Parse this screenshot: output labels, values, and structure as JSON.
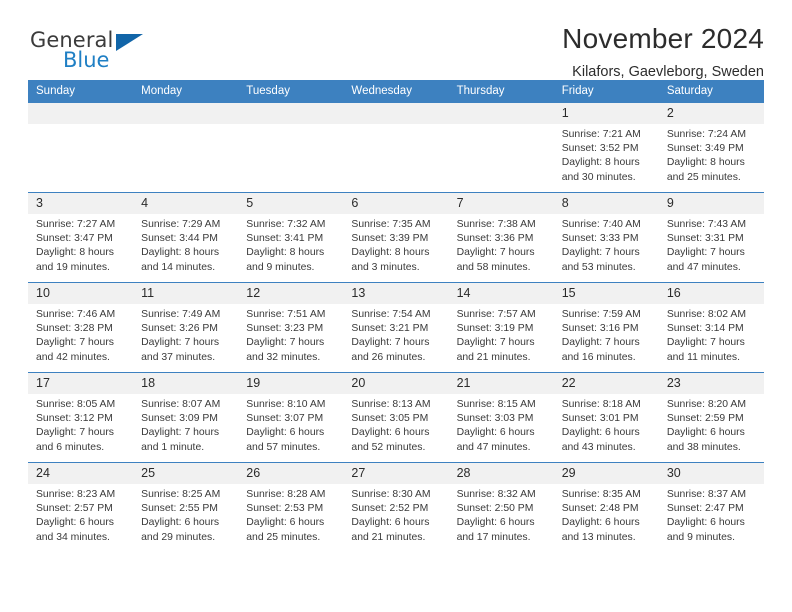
{
  "brand": {
    "name_part1": "General",
    "name_part2": "Blue",
    "triangle_color": "#1165a8",
    "blue_color": "#1f7fc4"
  },
  "header": {
    "title": "November 2024",
    "subtitle": "Kilafors, Gaevleborg, Sweden"
  },
  "theme": {
    "header_bg": "#3d81c0",
    "daynum_bg": "#f1f1f1",
    "row_border": "#3d81c0"
  },
  "weekdays": [
    "Sunday",
    "Monday",
    "Tuesday",
    "Wednesday",
    "Thursday",
    "Friday",
    "Saturday"
  ],
  "weeks": [
    [
      {
        "day": "",
        "sunrise": "",
        "sunset": "",
        "daylight1": "",
        "daylight2": ""
      },
      {
        "day": "",
        "sunrise": "",
        "sunset": "",
        "daylight1": "",
        "daylight2": ""
      },
      {
        "day": "",
        "sunrise": "",
        "sunset": "",
        "daylight1": "",
        "daylight2": ""
      },
      {
        "day": "",
        "sunrise": "",
        "sunset": "",
        "daylight1": "",
        "daylight2": ""
      },
      {
        "day": "",
        "sunrise": "",
        "sunset": "",
        "daylight1": "",
        "daylight2": ""
      },
      {
        "day": "1",
        "sunrise": "Sunrise: 7:21 AM",
        "sunset": "Sunset: 3:52 PM",
        "daylight1": "Daylight: 8 hours",
        "daylight2": "and 30 minutes."
      },
      {
        "day": "2",
        "sunrise": "Sunrise: 7:24 AM",
        "sunset": "Sunset: 3:49 PM",
        "daylight1": "Daylight: 8 hours",
        "daylight2": "and 25 minutes."
      }
    ],
    [
      {
        "day": "3",
        "sunrise": "Sunrise: 7:27 AM",
        "sunset": "Sunset: 3:47 PM",
        "daylight1": "Daylight: 8 hours",
        "daylight2": "and 19 minutes."
      },
      {
        "day": "4",
        "sunrise": "Sunrise: 7:29 AM",
        "sunset": "Sunset: 3:44 PM",
        "daylight1": "Daylight: 8 hours",
        "daylight2": "and 14 minutes."
      },
      {
        "day": "5",
        "sunrise": "Sunrise: 7:32 AM",
        "sunset": "Sunset: 3:41 PM",
        "daylight1": "Daylight: 8 hours",
        "daylight2": "and 9 minutes."
      },
      {
        "day": "6",
        "sunrise": "Sunrise: 7:35 AM",
        "sunset": "Sunset: 3:39 PM",
        "daylight1": "Daylight: 8 hours",
        "daylight2": "and 3 minutes."
      },
      {
        "day": "7",
        "sunrise": "Sunrise: 7:38 AM",
        "sunset": "Sunset: 3:36 PM",
        "daylight1": "Daylight: 7 hours",
        "daylight2": "and 58 minutes."
      },
      {
        "day": "8",
        "sunrise": "Sunrise: 7:40 AM",
        "sunset": "Sunset: 3:33 PM",
        "daylight1": "Daylight: 7 hours",
        "daylight2": "and 53 minutes."
      },
      {
        "day": "9",
        "sunrise": "Sunrise: 7:43 AM",
        "sunset": "Sunset: 3:31 PM",
        "daylight1": "Daylight: 7 hours",
        "daylight2": "and 47 minutes."
      }
    ],
    [
      {
        "day": "10",
        "sunrise": "Sunrise: 7:46 AM",
        "sunset": "Sunset: 3:28 PM",
        "daylight1": "Daylight: 7 hours",
        "daylight2": "and 42 minutes."
      },
      {
        "day": "11",
        "sunrise": "Sunrise: 7:49 AM",
        "sunset": "Sunset: 3:26 PM",
        "daylight1": "Daylight: 7 hours",
        "daylight2": "and 37 minutes."
      },
      {
        "day": "12",
        "sunrise": "Sunrise: 7:51 AM",
        "sunset": "Sunset: 3:23 PM",
        "daylight1": "Daylight: 7 hours",
        "daylight2": "and 32 minutes."
      },
      {
        "day": "13",
        "sunrise": "Sunrise: 7:54 AM",
        "sunset": "Sunset: 3:21 PM",
        "daylight1": "Daylight: 7 hours",
        "daylight2": "and 26 minutes."
      },
      {
        "day": "14",
        "sunrise": "Sunrise: 7:57 AM",
        "sunset": "Sunset: 3:19 PM",
        "daylight1": "Daylight: 7 hours",
        "daylight2": "and 21 minutes."
      },
      {
        "day": "15",
        "sunrise": "Sunrise: 7:59 AM",
        "sunset": "Sunset: 3:16 PM",
        "daylight1": "Daylight: 7 hours",
        "daylight2": "and 16 minutes."
      },
      {
        "day": "16",
        "sunrise": "Sunrise: 8:02 AM",
        "sunset": "Sunset: 3:14 PM",
        "daylight1": "Daylight: 7 hours",
        "daylight2": "and 11 minutes."
      }
    ],
    [
      {
        "day": "17",
        "sunrise": "Sunrise: 8:05 AM",
        "sunset": "Sunset: 3:12 PM",
        "daylight1": "Daylight: 7 hours",
        "daylight2": "and 6 minutes."
      },
      {
        "day": "18",
        "sunrise": "Sunrise: 8:07 AM",
        "sunset": "Sunset: 3:09 PM",
        "daylight1": "Daylight: 7 hours",
        "daylight2": "and 1 minute."
      },
      {
        "day": "19",
        "sunrise": "Sunrise: 8:10 AM",
        "sunset": "Sunset: 3:07 PM",
        "daylight1": "Daylight: 6 hours",
        "daylight2": "and 57 minutes."
      },
      {
        "day": "20",
        "sunrise": "Sunrise: 8:13 AM",
        "sunset": "Sunset: 3:05 PM",
        "daylight1": "Daylight: 6 hours",
        "daylight2": "and 52 minutes."
      },
      {
        "day": "21",
        "sunrise": "Sunrise: 8:15 AM",
        "sunset": "Sunset: 3:03 PM",
        "daylight1": "Daylight: 6 hours",
        "daylight2": "and 47 minutes."
      },
      {
        "day": "22",
        "sunrise": "Sunrise: 8:18 AM",
        "sunset": "Sunset: 3:01 PM",
        "daylight1": "Daylight: 6 hours",
        "daylight2": "and 43 minutes."
      },
      {
        "day": "23",
        "sunrise": "Sunrise: 8:20 AM",
        "sunset": "Sunset: 2:59 PM",
        "daylight1": "Daylight: 6 hours",
        "daylight2": "and 38 minutes."
      }
    ],
    [
      {
        "day": "24",
        "sunrise": "Sunrise: 8:23 AM",
        "sunset": "Sunset: 2:57 PM",
        "daylight1": "Daylight: 6 hours",
        "daylight2": "and 34 minutes."
      },
      {
        "day": "25",
        "sunrise": "Sunrise: 8:25 AM",
        "sunset": "Sunset: 2:55 PM",
        "daylight1": "Daylight: 6 hours",
        "daylight2": "and 29 minutes."
      },
      {
        "day": "26",
        "sunrise": "Sunrise: 8:28 AM",
        "sunset": "Sunset: 2:53 PM",
        "daylight1": "Daylight: 6 hours",
        "daylight2": "and 25 minutes."
      },
      {
        "day": "27",
        "sunrise": "Sunrise: 8:30 AM",
        "sunset": "Sunset: 2:52 PM",
        "daylight1": "Daylight: 6 hours",
        "daylight2": "and 21 minutes."
      },
      {
        "day": "28",
        "sunrise": "Sunrise: 8:32 AM",
        "sunset": "Sunset: 2:50 PM",
        "daylight1": "Daylight: 6 hours",
        "daylight2": "and 17 minutes."
      },
      {
        "day": "29",
        "sunrise": "Sunrise: 8:35 AM",
        "sunset": "Sunset: 2:48 PM",
        "daylight1": "Daylight: 6 hours",
        "daylight2": "and 13 minutes."
      },
      {
        "day": "30",
        "sunrise": "Sunrise: 8:37 AM",
        "sunset": "Sunset: 2:47 PM",
        "daylight1": "Daylight: 6 hours",
        "daylight2": "and 9 minutes."
      }
    ]
  ]
}
